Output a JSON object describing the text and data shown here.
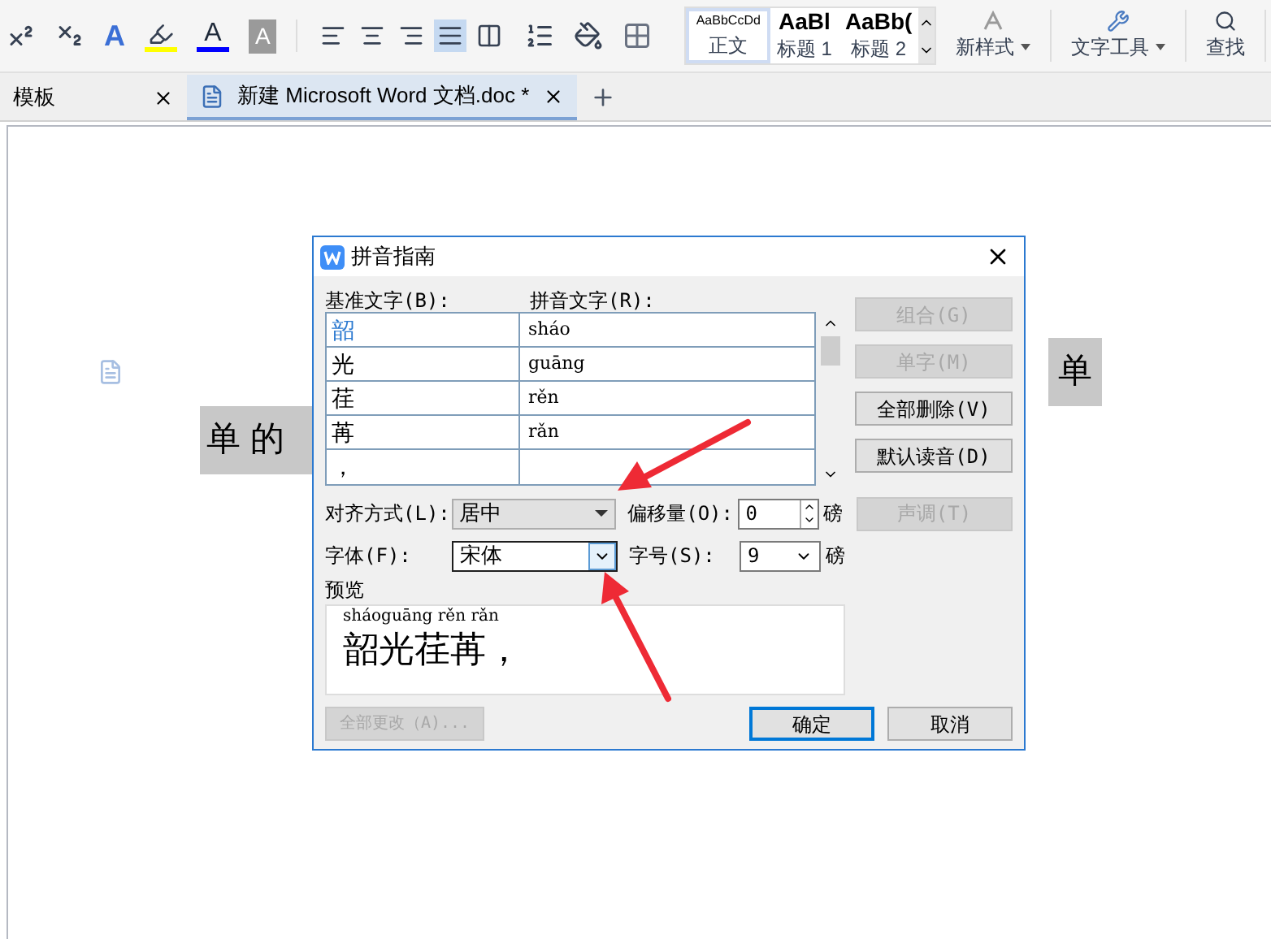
{
  "ribbon": {
    "font_tools": [
      {
        "kind": "superscript"
      },
      {
        "kind": "subscript"
      },
      {
        "kind": "effect",
        "glyph": "A"
      },
      {
        "kind": "highlight",
        "color": "#ffff00"
      },
      {
        "kind": "font_color",
        "glyph": "A",
        "color": "#0000ff"
      },
      {
        "kind": "shading",
        "glyph": "A"
      }
    ],
    "paragraph_tools": [
      {
        "kind": "left",
        "selected": false
      },
      {
        "kind": "center",
        "selected": false
      },
      {
        "kind": "right",
        "selected": false
      },
      {
        "kind": "justify",
        "selected": true
      },
      {
        "kind": "distributed",
        "selected": false
      }
    ],
    "styles": [
      {
        "preview": "AaBbCcDd",
        "label": "正文",
        "selected": true
      },
      {
        "preview": "AaBl",
        "label": "标题 1",
        "selected": false
      },
      {
        "preview": "AaBb(",
        "label": "标题 2",
        "selected": false
      }
    ],
    "commands": [
      {
        "label": "新样式",
        "menu": true
      },
      {
        "label": "文字工具",
        "menu": true
      },
      {
        "label": "查找",
        "menu": false
      }
    ]
  },
  "tabs": [
    {
      "label": "模板",
      "selected": false
    },
    {
      "label": "新建 Microsoft Word 文档.doc *",
      "selected": true
    }
  ],
  "document": {
    "line_1_right": "单",
    "line_2": "单 的"
  },
  "dialog": {
    "title": "拼音指南",
    "base_label": "基准文字(B):",
    "ruby_label": "拼音文字(R):",
    "rows": [
      {
        "base": "韶",
        "ruby": "sháo",
        "selected": true
      },
      {
        "base": "光",
        "ruby": "guāng",
        "selected": false
      },
      {
        "base": "荏",
        "ruby": "rěn",
        "selected": false
      },
      {
        "base": "苒",
        "ruby": "rǎn",
        "selected": false
      },
      {
        "base": "，",
        "selected": false
      }
    ],
    "side_buttons": [
      {
        "label": "组合(G)",
        "disabled": true
      },
      {
        "label": "单字(M)",
        "disabled": true
      },
      {
        "label": "全部删除(V)",
        "disabled": false
      },
      {
        "label": "默认读音(D)",
        "disabled": false
      }
    ],
    "align_label": "对齐方式(L):",
    "align_value": "居中",
    "offset_label": "偏移量(O):",
    "offset_value": "0",
    "offset_unit": "磅",
    "tone_button": {
      "label": "声调(T)",
      "disabled": true
    },
    "font_label": "字体(F):",
    "font_value": "宋体",
    "size_label": "字号(S):",
    "size_value": "9",
    "size_unit": "磅",
    "preview_label": "预览",
    "preview_ruby": "sháoguāng rěn rǎn",
    "preview_text": "韶光荏苒，",
    "apply_all": {
      "label": "全部更改（A)...",
      "disabled": true
    },
    "ok": "确定",
    "cancel": "取消"
  }
}
